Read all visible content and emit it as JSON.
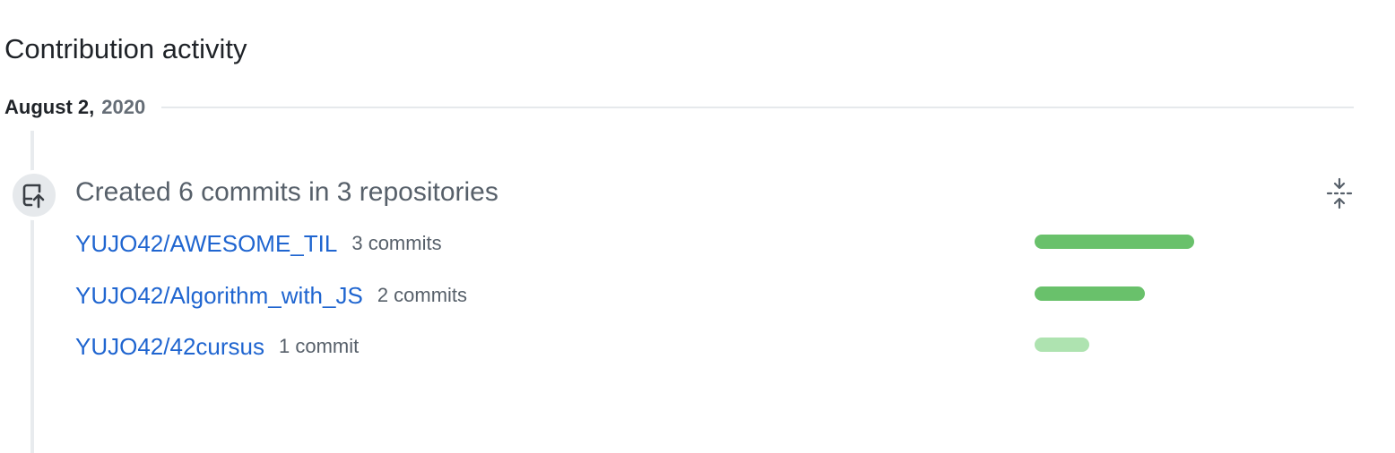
{
  "section": {
    "title": "Contribution activity"
  },
  "date": {
    "month_day": "August 2,",
    "year": "2020"
  },
  "event": {
    "icon": "repo-push-icon",
    "summary": "Created 6 commits in 3 repositories",
    "collapse_icon": "fold-icon"
  },
  "repos": [
    {
      "name": "YUJO42/AWESOME_TIL",
      "count_label": "3 commits",
      "commits": 3,
      "fraction": 1.0,
      "color": "#69c16b"
    },
    {
      "name": "YUJO42/Algorithm_with_JS",
      "count_label": "2 commits",
      "commits": 2,
      "fraction": 0.69,
      "color": "#69c16b"
    },
    {
      "name": "YUJO42/42cursus",
      "count_label": "1 commit",
      "commits": 1,
      "fraction": 0.34,
      "color": "#aee3b0"
    }
  ],
  "colors": {
    "link": "#1f65d0",
    "bar_strong": "#69c16b",
    "bar_light": "#aee3b0"
  }
}
